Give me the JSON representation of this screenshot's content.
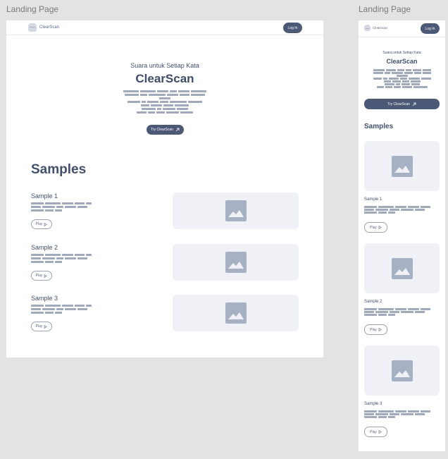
{
  "frames": {
    "desktop_label": "Landing Page",
    "mobile_label": "Landing Page"
  },
  "nav": {
    "logo_text": "ClearScan",
    "login_label": "Log In"
  },
  "hero": {
    "tagline": "Suara untuk Setiap Kata",
    "title": "ClearScan",
    "cta_label": "Try ClearScan",
    "cta_icon": "arrow-up-right-icon"
  },
  "samples": {
    "heading": "Samples",
    "items": [
      {
        "title": "Sample 1",
        "play_label": "Play"
      },
      {
        "title": "Sample 2",
        "play_label": "Play"
      },
      {
        "title": "Sample 3",
        "play_label": "Play"
      }
    ],
    "image_icon": "image-icon",
    "play_icon": "play-icon"
  },
  "colors": {
    "page_background": "#e3e3e3",
    "frame_background": "#ffffff",
    "primary_button": "#4b5876",
    "heading_text": "#43506b",
    "placeholder_bar": "#a1aabb",
    "image_card": "#eff1f6",
    "image_icon": "#a7b1c4"
  }
}
